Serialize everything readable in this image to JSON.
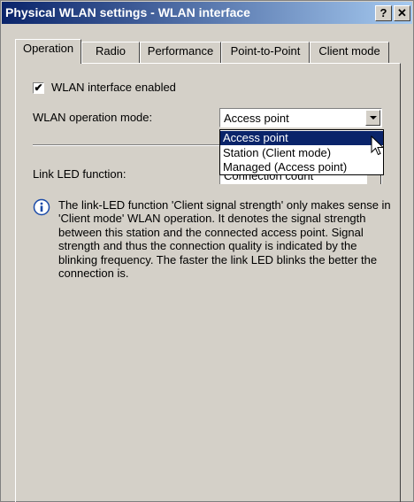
{
  "window": {
    "title": "Physical WLAN settings - WLAN interface",
    "help_button": "?",
    "close_button": "✕"
  },
  "tabs": [
    {
      "label": "Operation",
      "active": true
    },
    {
      "label": "Radio",
      "active": false
    },
    {
      "label": "Performance",
      "active": false
    },
    {
      "label": "Point-to-Point",
      "active": false
    },
    {
      "label": "Client mode",
      "active": false
    }
  ],
  "operation": {
    "wlan_enabled_label": "WLAN interface enabled",
    "wlan_enabled_checked": true,
    "check_mark": "✔",
    "mode_label": "WLAN operation mode:",
    "mode_value": "Access point",
    "mode_options": [
      "Access point",
      "Station (Client mode)",
      "Managed (Access point)"
    ],
    "led_label": "Link LED function:",
    "led_value": "Connection count",
    "info_text": "The link-LED function 'Client signal strength' only makes sense in 'Client mode' WLAN operation. It denotes the signal strength between this station and the connected access point. Signal strength and thus the connection quality is indicated by the blinking frequency. The faster the link LED blinks the better the connection is."
  },
  "icons": {
    "info": "info-icon",
    "cursor": "mouse-pointer-icon",
    "dropdown": "chevron-down-icon"
  },
  "colors": {
    "title_bar_start": "#0a246a",
    "title_bar_end": "#a6caf0",
    "dialog_face": "#d4d0c8",
    "selection": "#0a246a"
  }
}
